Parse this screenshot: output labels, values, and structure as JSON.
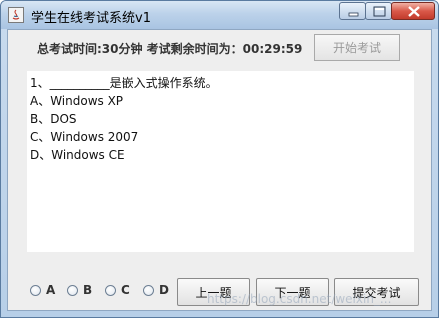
{
  "window": {
    "title": "学生在线考试系统v1"
  },
  "header": {
    "time_info": "总考试时间:30分钟  考试剩余时间为：00:29:59",
    "start_button": "开始考试"
  },
  "question": {
    "text": "1、__________是嵌入式操作系统。",
    "options": [
      "A、Windows XP",
      "B、DOS",
      "C、Windows 2007",
      "D、Windows CE"
    ]
  },
  "answers": [
    "A",
    "B",
    "C",
    "D"
  ],
  "buttons": {
    "prev": "上一题",
    "next": "下一题",
    "submit": "提交考试"
  },
  "watermark": "https://blog.csdn.net/weixin_..."
}
